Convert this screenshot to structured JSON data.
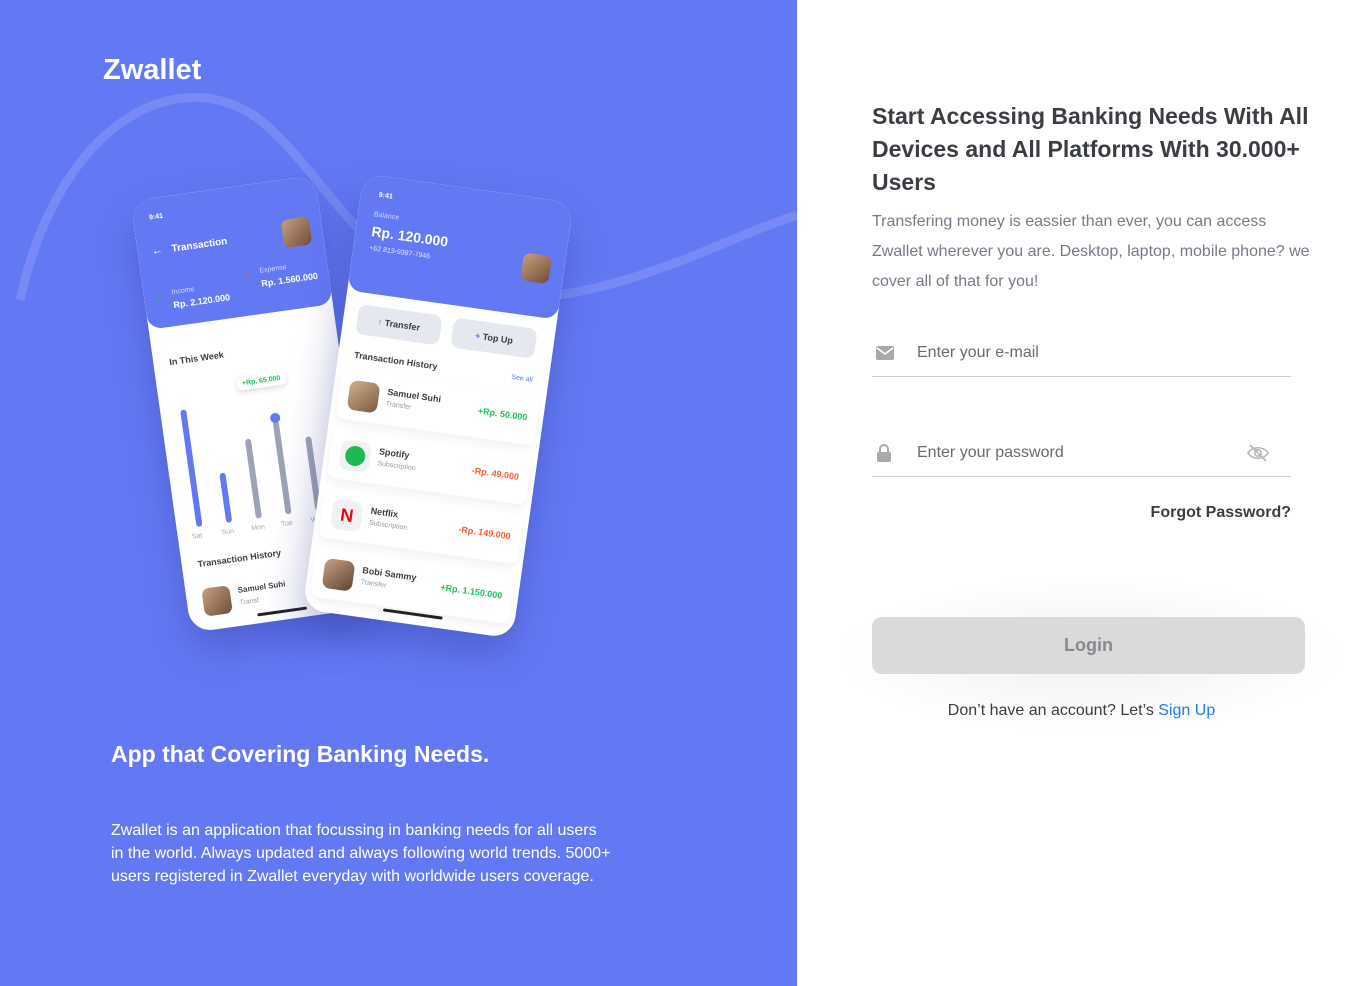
{
  "brand": "Zwallet",
  "colors": {
    "primary": "#6379F4",
    "income": "#1EC15F",
    "expense": "#FF5B37",
    "link": "#1d7ce6"
  },
  "left": {
    "headline": "App that Covering Banking Needs.",
    "description": "Zwallet is an application that focussing in banking needs for all users in the world. Always updated and always following world trends. 5000+ users registered in Zwallet everyday with worldwide users coverage."
  },
  "phone_transaction": {
    "time": "9:41",
    "title": "Transaction",
    "income_label": "Income",
    "income_value": "Rp. 2.120.000",
    "expense_label": "Expense",
    "expense_value": "Rp. 1.560.000",
    "week_label": "In This Week",
    "tooltip": "+Rp. 65.000",
    "days": [
      "Sat",
      "Sun",
      "Mon",
      "Tue",
      "W"
    ],
    "history_label": "Transaction History",
    "history_item_name": "Samuel Suhi",
    "history_item_sub": "Transf"
  },
  "phone_balance": {
    "time": "9:41",
    "balance_label": "Balance",
    "balance_value": "Rp. 120.000",
    "phone": "+62 813-9387-7946",
    "transfer_label": "Transfer",
    "topup_label": "Top Up",
    "history_label": "Transaction History",
    "see_all": "See all",
    "transactions": [
      {
        "name": "Samuel Suhi",
        "type": "Transfer",
        "amount": "+Rp. 50.000"
      },
      {
        "name": "Spotify",
        "type": "Subscription",
        "amount": "-Rp. 49.000"
      },
      {
        "name": "Netflix",
        "type": "Subscription",
        "amount": "-Rp. 149.000"
      },
      {
        "name": "Bobi Sammy",
        "type": "Transfer",
        "amount": "+Rp. 1.150.000"
      }
    ]
  },
  "right": {
    "title": "Start Accessing Banking Needs With All Devices and All Platforms With 30.000+ Users",
    "description": "Transfering money is eassier than ever, you can access Zwallet wherever you are. Desktop, laptop, mobile phone? we cover all of that for you!",
    "email_placeholder": "Enter your e-mail",
    "password_placeholder": "Enter your password",
    "forgot": "Forgot Password?",
    "login": "Login",
    "signup_prefix": "Don’t have an account? Let’s ",
    "signup_link": "Sign Up"
  },
  "icons": {
    "email": "envelope-icon",
    "password": "lock-icon",
    "toggle": "eye-slash-icon"
  }
}
